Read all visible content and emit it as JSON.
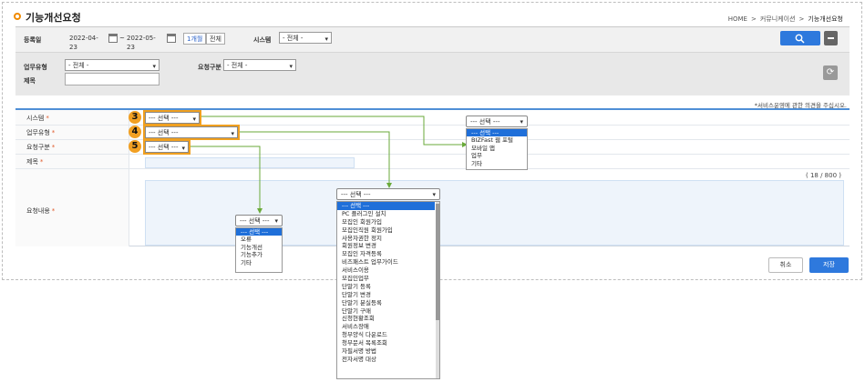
{
  "header": {
    "title": "기능개선요청",
    "breadcrumb": [
      "HOME",
      "커뮤니케이션",
      "기능개선요청"
    ]
  },
  "search": {
    "reg_date_label": "등록일",
    "date_from": "2022-04-23",
    "date_to": "2022-05-23",
    "one_month": "1개월",
    "all": "전체",
    "system_label": "시스템",
    "system_value": "- 전체 -",
    "task_type_label": "업무유형",
    "task_type_value": "- 전체 -",
    "req_type_label": "요청구분",
    "req_type_value": "- 전체 -",
    "title_label": "제목"
  },
  "notice": "*서비스운영에 관한 의견을 주십시오.",
  "form": {
    "system_label": "시스템",
    "task_type_label": "업무유형",
    "req_type_label": "요청구분",
    "title_label": "제목",
    "content_label": "요청내용",
    "required_mark": "*",
    "placeholder_select": "--- 선택 ---",
    "counter": "( 18 / 800 )"
  },
  "markers": [
    "3",
    "4",
    "5"
  ],
  "buttons": {
    "cancel": "취소",
    "save": "저장"
  },
  "dropdown_system": {
    "head": "--- 선택 ---",
    "items": [
      "--- 선택 ---",
      "BIZFast 웹 포털",
      "모바일 앱",
      "업무",
      "기타"
    ]
  },
  "dropdown_task": {
    "head": "--- 선택 ---",
    "items": [
      "--- 선택 ---",
      "PC 플러그인 설치",
      "모집인 회원가입",
      "모집인직원 회원가입",
      "사용자권한 정지",
      "회원정보 변경",
      "모집인 자격등록",
      "비즈패스트 업무가이드",
      "서비스이용",
      "모집인업무",
      "단말기 등록",
      "단말기 변경",
      "단말기 분실등록",
      "단말기 구매",
      "신청현황조회",
      "서비스장애",
      "청부양식 다운로드",
      "청부문서 목록조회",
      "자필서명 방법",
      "전자서명 대상"
    ]
  },
  "dropdown_req": {
    "head": "--- 선택 ---",
    "items": [
      "--- 선택 ---",
      "오류",
      "기능개선",
      "기능추가",
      "기타"
    ]
  },
  "colors": {
    "accent": "#2e79dd",
    "marker": "#f2a023",
    "arrow": "#6aaa3a"
  }
}
